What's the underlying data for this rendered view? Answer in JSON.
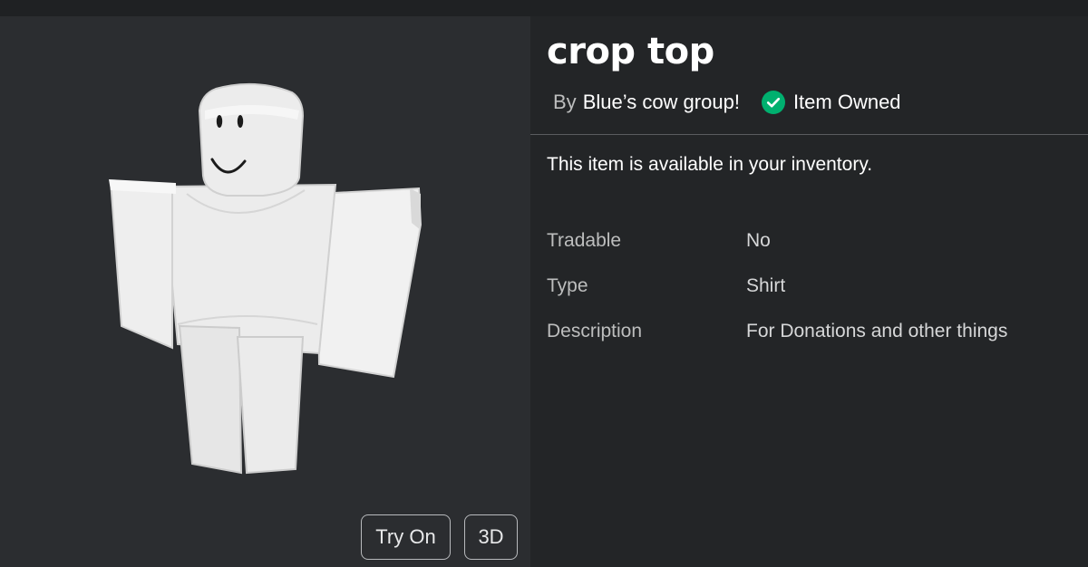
{
  "item": {
    "title": "crop top",
    "by_label": "By",
    "creator": "Blue’s cow group!",
    "owned_label": "Item Owned",
    "availability": "This item is available in your inventory."
  },
  "details": [
    {
      "label": "Tradable",
      "value": "No"
    },
    {
      "label": "Type",
      "value": "Shirt"
    },
    {
      "label": "Description",
      "value": "For Donations and other things"
    }
  ],
  "viewer": {
    "try_on_label": "Try On",
    "three_d_label": "3D"
  },
  "icons": {
    "owned": "check-circle-icon"
  },
  "colors": {
    "background": "#232527",
    "viewer_background": "#2b2d30",
    "owned_green": "#00b06f",
    "divider": "#5a5c5f"
  }
}
